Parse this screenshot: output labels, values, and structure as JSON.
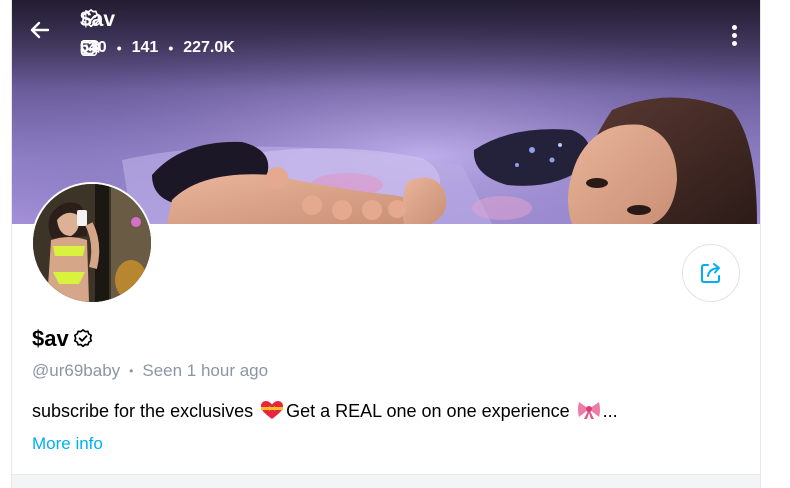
{
  "header": {
    "name": "$av",
    "stats": {
      "photos": "540",
      "videos": "141",
      "likes": "227.0K"
    }
  },
  "profile": {
    "name": "$av",
    "username": "@ur69baby",
    "last_seen": "Seen 1 hour ago",
    "bio_part1": "subscribe for the exclusives",
    "bio_part2": "Get a REAL one on one experience",
    "bio_ellipsis": "...",
    "more_info": "More info"
  },
  "icons": {
    "back": "arrow-left-icon",
    "verified": "verified-badge-icon",
    "photos": "image-icon",
    "videos": "video-camera-icon",
    "likes": "heart-icon",
    "menu": "more-vertical-icon",
    "share": "share-icon",
    "emoji1": "heart-with-ribbon-emoji",
    "emoji2": "ribbon-emoji"
  },
  "colors": {
    "accent": "#00aff0",
    "muted": "#8a96a3"
  }
}
